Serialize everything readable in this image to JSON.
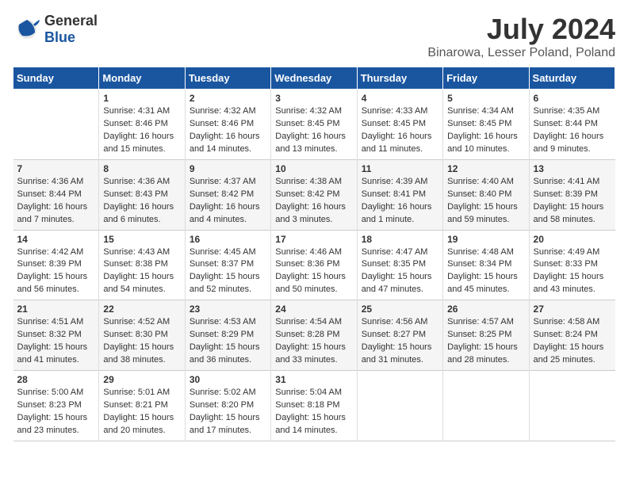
{
  "header": {
    "logo": {
      "general": "General",
      "blue": "Blue"
    },
    "title": "July 2024",
    "subtitle": "Binarowa, Lesser Poland, Poland"
  },
  "calendar": {
    "weekdays": [
      "Sunday",
      "Monday",
      "Tuesday",
      "Wednesday",
      "Thursday",
      "Friday",
      "Saturday"
    ],
    "weeks": [
      [
        {
          "day": "",
          "content": ""
        },
        {
          "day": "1",
          "content": "Sunrise: 4:31 AM\nSunset: 8:46 PM\nDaylight: 16 hours\nand 15 minutes."
        },
        {
          "day": "2",
          "content": "Sunrise: 4:32 AM\nSunset: 8:46 PM\nDaylight: 16 hours\nand 14 minutes."
        },
        {
          "day": "3",
          "content": "Sunrise: 4:32 AM\nSunset: 8:45 PM\nDaylight: 16 hours\nand 13 minutes."
        },
        {
          "day": "4",
          "content": "Sunrise: 4:33 AM\nSunset: 8:45 PM\nDaylight: 16 hours\nand 11 minutes."
        },
        {
          "day": "5",
          "content": "Sunrise: 4:34 AM\nSunset: 8:45 PM\nDaylight: 16 hours\nand 10 minutes."
        },
        {
          "day": "6",
          "content": "Sunrise: 4:35 AM\nSunset: 8:44 PM\nDaylight: 16 hours\nand 9 minutes."
        }
      ],
      [
        {
          "day": "7",
          "content": "Sunrise: 4:36 AM\nSunset: 8:44 PM\nDaylight: 16 hours\nand 7 minutes."
        },
        {
          "day": "8",
          "content": "Sunrise: 4:36 AM\nSunset: 8:43 PM\nDaylight: 16 hours\nand 6 minutes."
        },
        {
          "day": "9",
          "content": "Sunrise: 4:37 AM\nSunset: 8:42 PM\nDaylight: 16 hours\nand 4 minutes."
        },
        {
          "day": "10",
          "content": "Sunrise: 4:38 AM\nSunset: 8:42 PM\nDaylight: 16 hours\nand 3 minutes."
        },
        {
          "day": "11",
          "content": "Sunrise: 4:39 AM\nSunset: 8:41 PM\nDaylight: 16 hours\nand 1 minute."
        },
        {
          "day": "12",
          "content": "Sunrise: 4:40 AM\nSunset: 8:40 PM\nDaylight: 15 hours\nand 59 minutes."
        },
        {
          "day": "13",
          "content": "Sunrise: 4:41 AM\nSunset: 8:39 PM\nDaylight: 15 hours\nand 58 minutes."
        }
      ],
      [
        {
          "day": "14",
          "content": "Sunrise: 4:42 AM\nSunset: 8:39 PM\nDaylight: 15 hours\nand 56 minutes."
        },
        {
          "day": "15",
          "content": "Sunrise: 4:43 AM\nSunset: 8:38 PM\nDaylight: 15 hours\nand 54 minutes."
        },
        {
          "day": "16",
          "content": "Sunrise: 4:45 AM\nSunset: 8:37 PM\nDaylight: 15 hours\nand 52 minutes."
        },
        {
          "day": "17",
          "content": "Sunrise: 4:46 AM\nSunset: 8:36 PM\nDaylight: 15 hours\nand 50 minutes."
        },
        {
          "day": "18",
          "content": "Sunrise: 4:47 AM\nSunset: 8:35 PM\nDaylight: 15 hours\nand 47 minutes."
        },
        {
          "day": "19",
          "content": "Sunrise: 4:48 AM\nSunset: 8:34 PM\nDaylight: 15 hours\nand 45 minutes."
        },
        {
          "day": "20",
          "content": "Sunrise: 4:49 AM\nSunset: 8:33 PM\nDaylight: 15 hours\nand 43 minutes."
        }
      ],
      [
        {
          "day": "21",
          "content": "Sunrise: 4:51 AM\nSunset: 8:32 PM\nDaylight: 15 hours\nand 41 minutes."
        },
        {
          "day": "22",
          "content": "Sunrise: 4:52 AM\nSunset: 8:30 PM\nDaylight: 15 hours\nand 38 minutes."
        },
        {
          "day": "23",
          "content": "Sunrise: 4:53 AM\nSunset: 8:29 PM\nDaylight: 15 hours\nand 36 minutes."
        },
        {
          "day": "24",
          "content": "Sunrise: 4:54 AM\nSunset: 8:28 PM\nDaylight: 15 hours\nand 33 minutes."
        },
        {
          "day": "25",
          "content": "Sunrise: 4:56 AM\nSunset: 8:27 PM\nDaylight: 15 hours\nand 31 minutes."
        },
        {
          "day": "26",
          "content": "Sunrise: 4:57 AM\nSunset: 8:25 PM\nDaylight: 15 hours\nand 28 minutes."
        },
        {
          "day": "27",
          "content": "Sunrise: 4:58 AM\nSunset: 8:24 PM\nDaylight: 15 hours\nand 25 minutes."
        }
      ],
      [
        {
          "day": "28",
          "content": "Sunrise: 5:00 AM\nSunset: 8:23 PM\nDaylight: 15 hours\nand 23 minutes."
        },
        {
          "day": "29",
          "content": "Sunrise: 5:01 AM\nSunset: 8:21 PM\nDaylight: 15 hours\nand 20 minutes."
        },
        {
          "day": "30",
          "content": "Sunrise: 5:02 AM\nSunset: 8:20 PM\nDaylight: 15 hours\nand 17 minutes."
        },
        {
          "day": "31",
          "content": "Sunrise: 5:04 AM\nSunset: 8:18 PM\nDaylight: 15 hours\nand 14 minutes."
        },
        {
          "day": "",
          "content": ""
        },
        {
          "day": "",
          "content": ""
        },
        {
          "day": "",
          "content": ""
        }
      ]
    ]
  }
}
